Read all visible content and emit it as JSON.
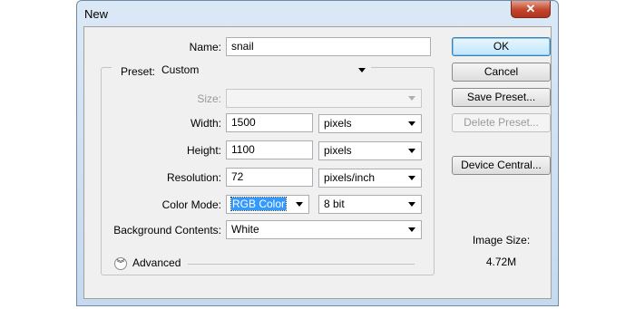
{
  "window": {
    "title": "New",
    "close_glyph": "✕"
  },
  "form": {
    "name": {
      "label": "Name:",
      "value": "snail"
    },
    "preset": {
      "label": "Preset:",
      "value": "Custom"
    },
    "size": {
      "label": "Size:",
      "value": ""
    },
    "width": {
      "label": "Width:",
      "value": "1500",
      "unit": "pixels"
    },
    "height": {
      "label": "Height:",
      "value": "1100",
      "unit": "pixels"
    },
    "resolution": {
      "label": "Resolution:",
      "value": "72",
      "unit": "pixels/inch"
    },
    "color_mode": {
      "label": "Color Mode:",
      "value": "RGB Color",
      "depth": "8 bit"
    },
    "background": {
      "label": "Background Contents:",
      "value": "White"
    },
    "advanced": {
      "label": "Advanced"
    }
  },
  "buttons": {
    "ok": "OK",
    "cancel": "Cancel",
    "save_preset": "Save Preset...",
    "delete_preset": "Delete Preset...",
    "device_central": "Device Central..."
  },
  "image_size": {
    "label": "Image Size:",
    "value": "4.72M"
  },
  "colors": {
    "accent": "#3399ff",
    "close": "#c2452c",
    "frame": "#c6d9ee"
  }
}
